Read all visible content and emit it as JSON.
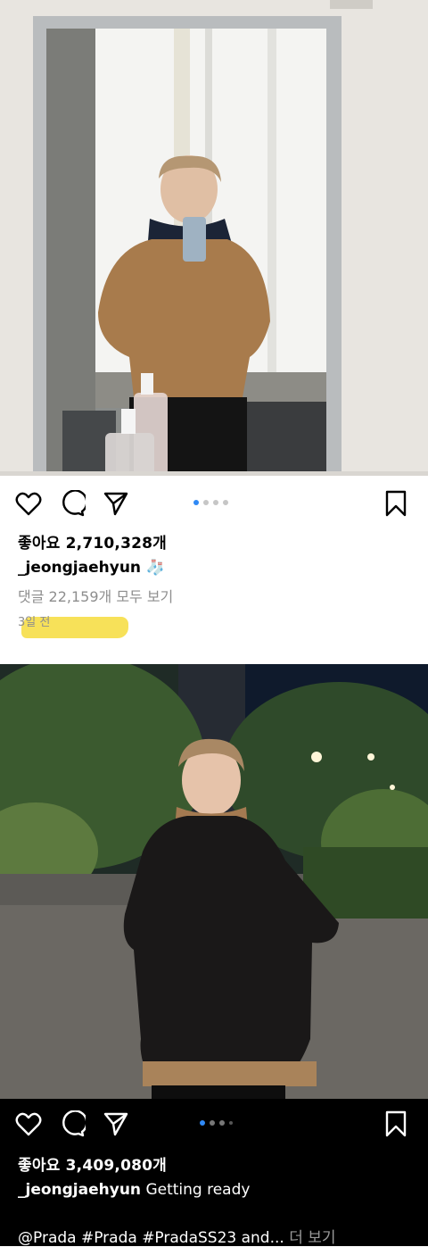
{
  "post1": {
    "likes_text": "좋아요 2,710,328개",
    "username": "_jeongjaehyun",
    "caption_emoji": "🧦",
    "comments_text": "댓글 22,159개 모두 보기",
    "time_text": "3일 전",
    "carousel_count": 4,
    "carousel_active": 1
  },
  "post2": {
    "likes_text": "좋아요 3,409,080개",
    "username": "_jeongjaehyun",
    "caption_text": "Getting ready",
    "hashtags_text": "@Prada #Prada #PradaSS23 and...",
    "more_text": "더 보기",
    "carousel_count": 4,
    "carousel_active": 1
  },
  "colors": {
    "carousel_active": "#2f89f5",
    "highlight": "#f6dc3c"
  },
  "icons": [
    "heart-icon",
    "comment-icon",
    "share-icon",
    "bookmark-icon"
  ]
}
